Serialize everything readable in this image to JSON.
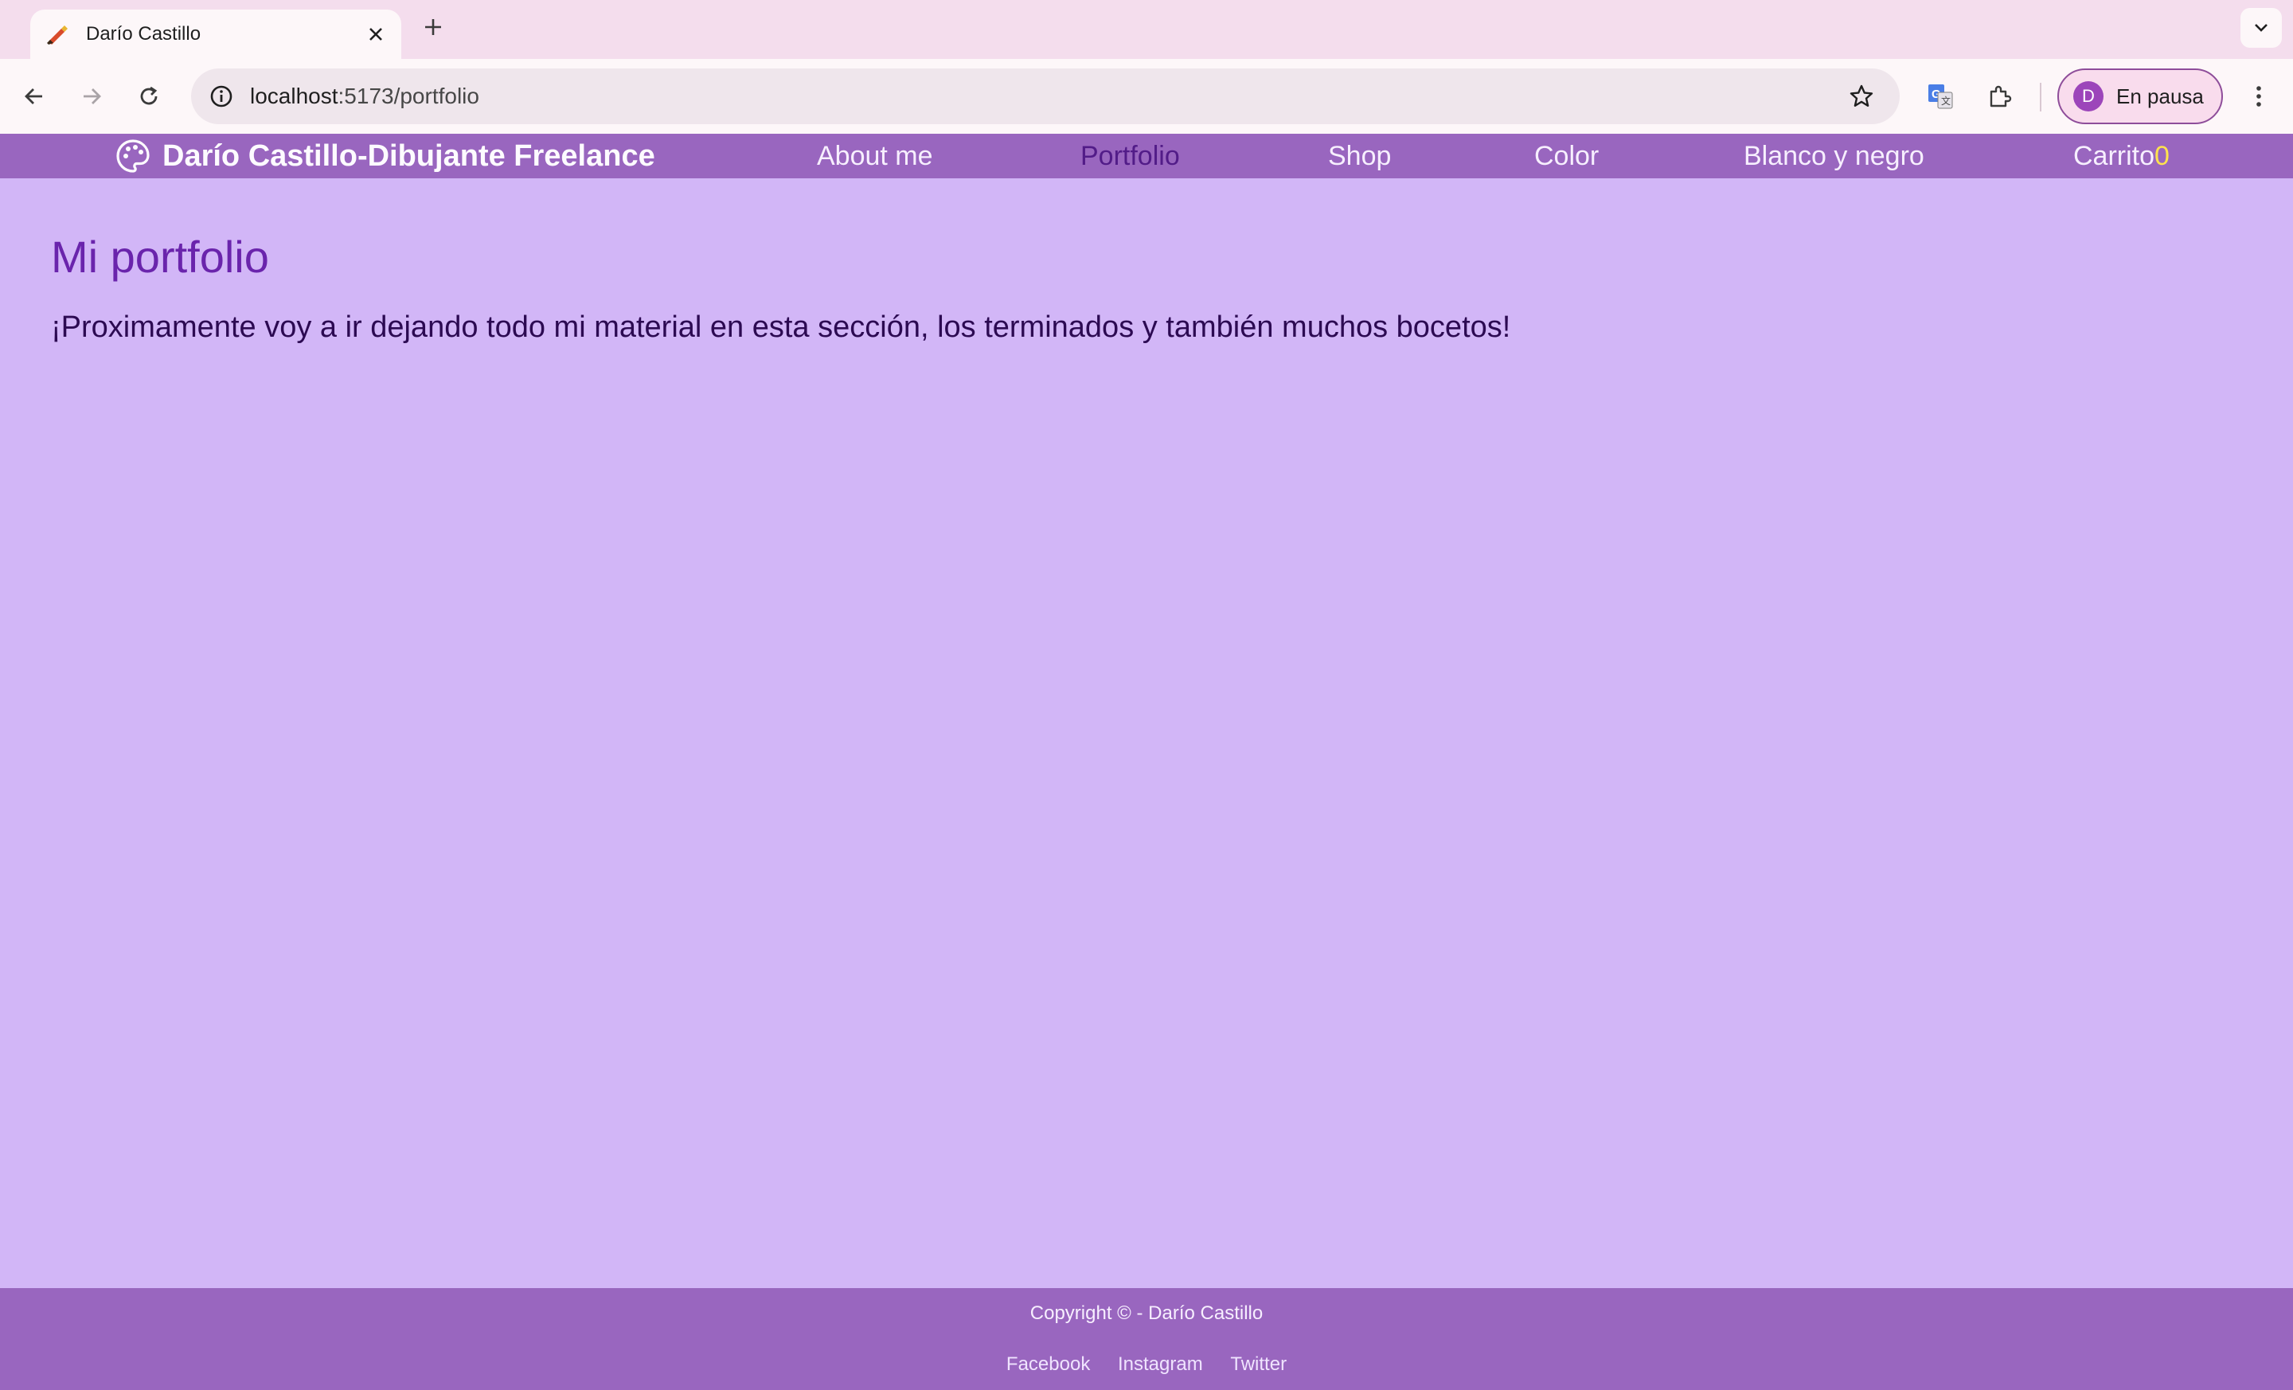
{
  "browser": {
    "tab": {
      "title": "Darío Castillo"
    },
    "omnibox": {
      "host": "localhost",
      "path": ":5173/portfolio"
    },
    "profile": {
      "initial": "D",
      "label": "En pausa"
    }
  },
  "site": {
    "brand": "Darío Castillo-Dibujante Freelance",
    "nav": {
      "about": "About me",
      "portfolio": "Portfolio",
      "shop": "Shop",
      "color": "Color",
      "bw": "Blanco y negro",
      "cart_label": "Carrito",
      "cart_count": "0"
    },
    "colors": {
      "nav_bg": "#9966bf",
      "page_bg": "#d2b6f7",
      "active_link": "#521c88",
      "cart_count": "#ffe34d"
    }
  },
  "main": {
    "title": "Mi portfolio",
    "lead": "¡Proximamente voy a ir dejando todo mi material en esta sección, los terminados y también muchos bocetos!"
  },
  "footer": {
    "copyright": "Copyright © - Darío Castillo",
    "links": {
      "facebook": "Facebook",
      "instagram": "Instagram",
      "twitter": "Twitter"
    }
  },
  "icons": [
    "palette-favicon-icon",
    "close-icon",
    "plus-icon",
    "chevron-down-icon",
    "back-arrow-icon",
    "forward-arrow-icon",
    "reload-icon",
    "site-info-icon",
    "bookmark-star-icon",
    "translate-icon",
    "extensions-icon",
    "kebab-menu-icon",
    "palette-icon"
  ]
}
